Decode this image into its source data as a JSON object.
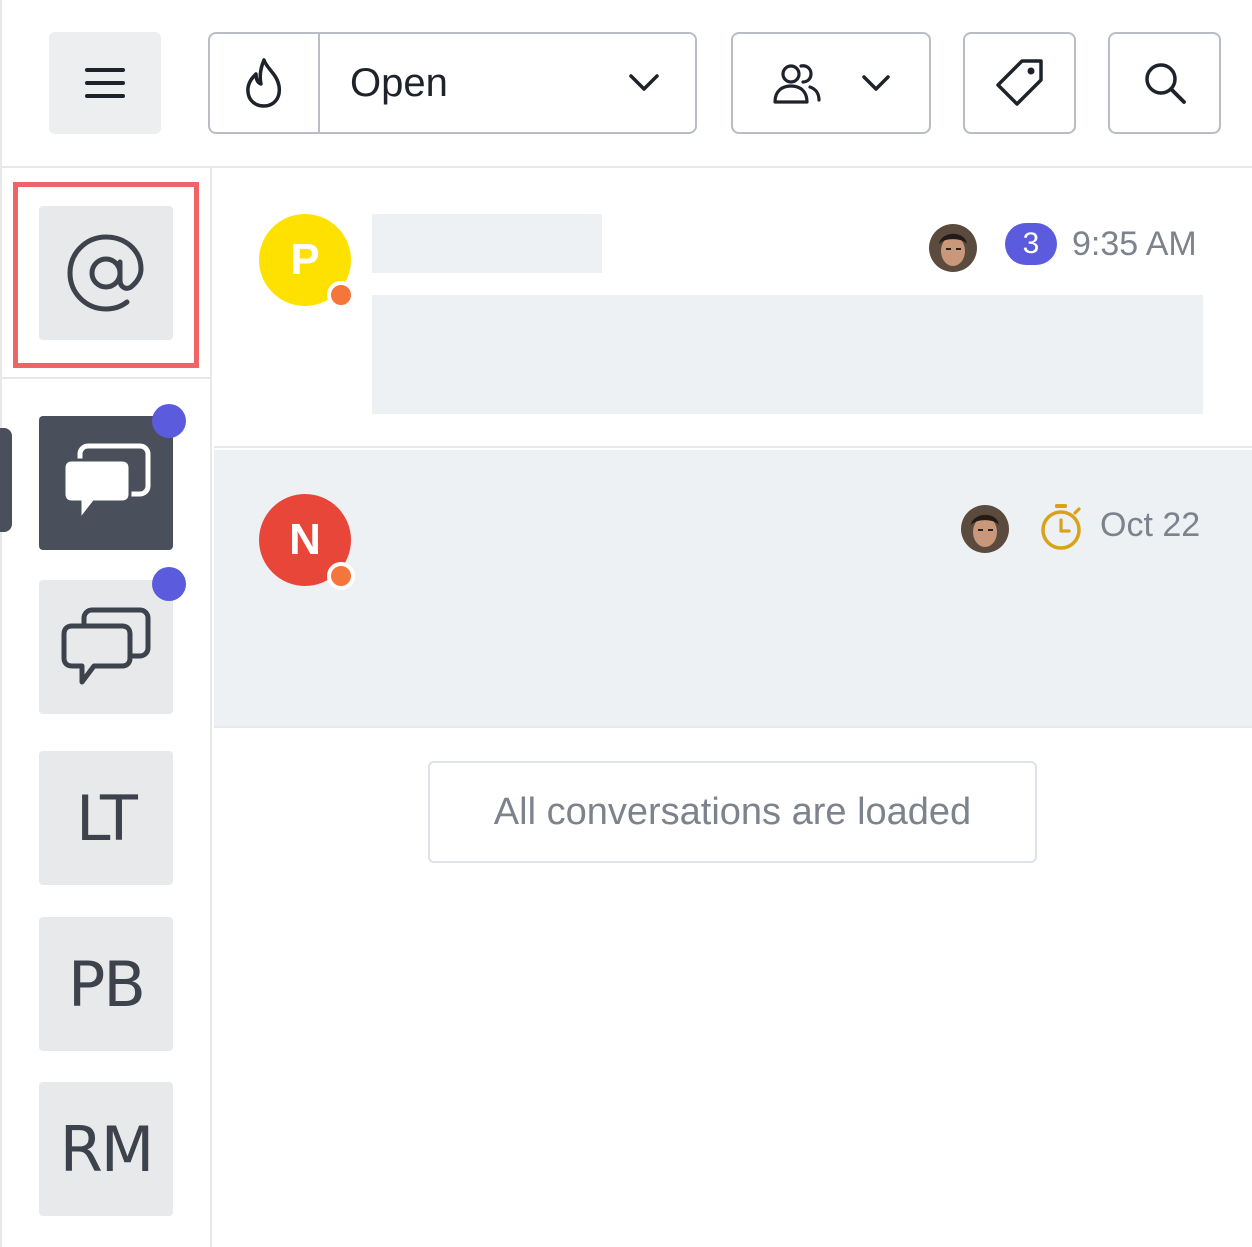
{
  "header": {
    "status_filter": {
      "selected": "Open"
    },
    "icons": {
      "menu": "hamburger-icon",
      "priority": "fire-icon",
      "chevron": "chevron-down-icon",
      "assignee": "users-icon",
      "tags": "tag-icon",
      "search": "search-icon"
    }
  },
  "sidebar": {
    "items": [
      {
        "kind": "icon",
        "icon": "at-icon",
        "highlighted": true
      },
      {
        "kind": "icon",
        "icon": "chat-filled-icon",
        "active": true,
        "unread_dot": true
      },
      {
        "kind": "icon",
        "icon": "chat-outline-icon",
        "unread_dot": true
      },
      {
        "kind": "text",
        "label": "LT"
      },
      {
        "kind": "text",
        "label": "PB"
      },
      {
        "kind": "text",
        "label": "RM"
      }
    ]
  },
  "conversations": [
    {
      "initial": "P",
      "avatar_color": "#ffe100",
      "unread_count": "3",
      "time": "9:35 AM"
    },
    {
      "initial": "N",
      "avatar_color": "#e9463a",
      "time": "Oct 22",
      "timer_icon": "stopwatch-icon"
    }
  ],
  "footer": {
    "loaded_message": "All conversations are loaded"
  },
  "colors": {
    "accent": "#5b5bde",
    "highlight": "#ef6565",
    "status_away": "#f4763b",
    "timer": "#d9a21b"
  }
}
